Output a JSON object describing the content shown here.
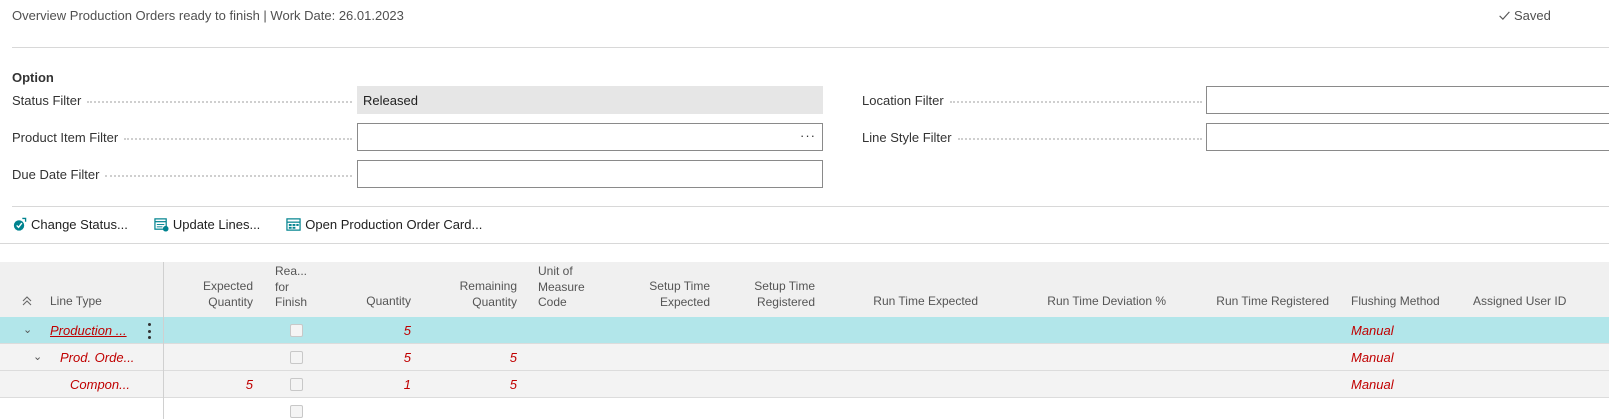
{
  "header": {
    "title": "Overview Production Orders ready to finish | Work Date: 26.01.2023",
    "saved_label": "Saved"
  },
  "options": {
    "section_title": "Option",
    "status_filter": {
      "label": "Status Filter",
      "value": "Released"
    },
    "product_item_filter": {
      "label": "Product Item Filter",
      "value": "",
      "lookup": "···"
    },
    "due_date_filter": {
      "label": "Due Date Filter",
      "value": ""
    },
    "location_filter": {
      "label": "Location Filter",
      "value": ""
    },
    "line_style_filter": {
      "label": "Line Style Filter",
      "value": ""
    }
  },
  "actions": [
    {
      "label": "Change Status...",
      "icon": "change-status-icon"
    },
    {
      "label": "Update Lines...",
      "icon": "update-lines-icon"
    },
    {
      "label": "Open Production Order Card...",
      "icon": "open-card-icon"
    }
  ],
  "grid": {
    "columns": {
      "line_type": "Line Type",
      "expected_qty_1": "Expected",
      "expected_qty_2": "Quantity",
      "ready_1": "Rea...",
      "ready_2": "for",
      "ready_3": "Finish",
      "quantity": "Quantity",
      "remaining_1": "Remaining",
      "remaining_2": "Quantity",
      "uom_1": "Unit of",
      "uom_2": "Measure",
      "uom_3": "Code",
      "setup_exp_1": "Setup Time",
      "setup_exp_2": "Expected",
      "setup_reg_1": "Setup Time",
      "setup_reg_2": "Registered",
      "run_expected": "Run Time Expected",
      "run_deviation": "Run Time Deviation %",
      "run_registered": "Run Time Registered",
      "flushing": "Flushing Method",
      "assigned_user": "Assigned User ID"
    },
    "rows": [
      {
        "line_type": "Production ...",
        "expected_qty": "",
        "quantity": "5",
        "remaining_qty": "",
        "flushing": "Manual"
      },
      {
        "line_type": "Prod. Orde...",
        "expected_qty": "",
        "quantity": "5",
        "remaining_qty": "5",
        "flushing": "Manual"
      },
      {
        "line_type": "Compon...",
        "expected_qty": "5",
        "quantity": "1",
        "remaining_qty": "5",
        "flushing": "Manual"
      }
    ]
  },
  "colors": {
    "selected_row": "#b2e6ea",
    "value_red": "#c00000",
    "accent_teal": "#00838f"
  }
}
